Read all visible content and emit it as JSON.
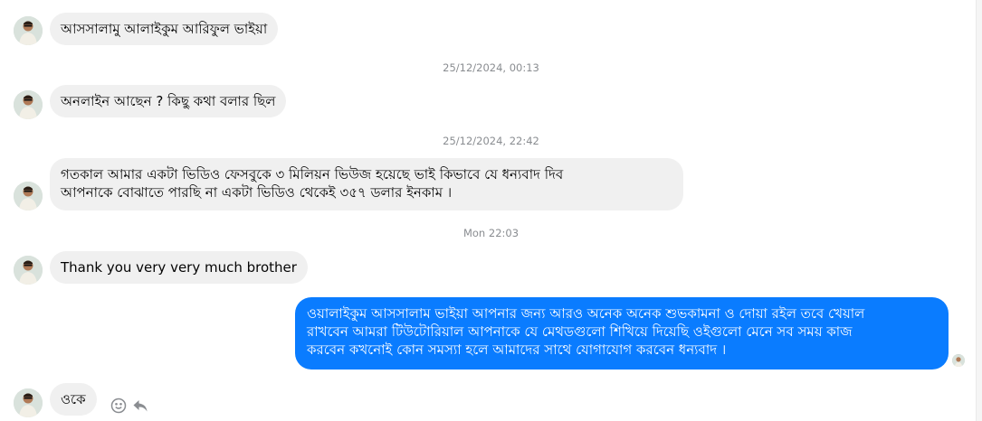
{
  "messages": [
    {
      "text": "আসসালামু আলাইকুম আরিফুল ভাইয়া"
    },
    {
      "text": "অনলাইন আছেন ? কিছু কথা বলার ছিল"
    },
    {
      "line1": "গতকাল আমার একটা ভিডিও ফেসবুকে ৩ মিলিয়ন ভিউজ হয়েছে ভাই কিভাবে যে ধন্যবাদ দিব",
      "line2": "আপনাকে বোঝাতে পারছি না একটা ভিডিও থেকেই ৩৫৭ ডলার ইনকাম ।"
    },
    {
      "text": "Thank you very very much brother"
    },
    {
      "line1": "ওয়ালাইকুম আসসালাম ভাইয়া আপনার জন্য আরও অনেক অনেক শুভকামনা ও দোয়া রইল তবে খেয়াল",
      "line2": "রাখবেন আমরা টিউটোরিয়াল আপনাকে যে মেথডগুলো শিখিয়ে দিয়েছি ওইগুলো মেনে সব সময় কাজ",
      "line3": "করবেন কখনোই কোন সমস্যা হলে আমাদের সাথে যোগাযোগ করবেন ধন্যবাদ ।"
    },
    {
      "text": "ওকে"
    }
  ],
  "timestamps": [
    "25/12/2024, 00:13",
    "25/12/2024, 22:42",
    "Mon 22:03"
  ],
  "icons": {
    "react": "smiley-icon",
    "reply": "reply-arrow-icon"
  },
  "colors": {
    "own_bubble": "#0a7cff",
    "other_bubble": "#f0f0f0",
    "timestamp": "#8a8d91"
  }
}
